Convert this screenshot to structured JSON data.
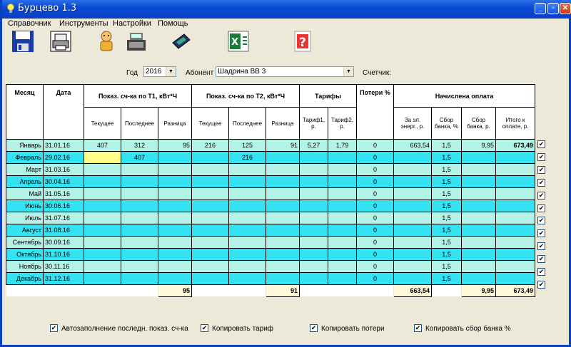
{
  "window": {
    "title": "Бурцево 1.3"
  },
  "menu": [
    "Справочник",
    "Инструменты",
    "Настройки",
    "Помощь"
  ],
  "toolbar": {
    "icons": [
      "save-icon",
      "print-icon",
      "person-icon",
      "cash-register-icon",
      "calculator-icon",
      "excel-icon",
      "help-icon"
    ]
  },
  "filter": {
    "year_label": "Год",
    "year_value": "2016",
    "subscriber_label": "Абонент",
    "subscriber_value": "Шадрина ВВ 3",
    "meter_label": "Счетчик:"
  },
  "headers": {
    "month": "Месяц",
    "date": "Дата",
    "t1": "Показ. сч-ка по Т1, кВт*Ч",
    "t2": "Показ. сч-ка по Т2, кВт*Ч",
    "tariffs": "Тарифы",
    "losses": "Потери %",
    "charged": "Начислена оплата",
    "t1_sub": [
      "Текущее",
      "Последнее",
      "Разница"
    ],
    "t2_sub": [
      "Текущее",
      "Последнее",
      "Разница"
    ],
    "tariff_sub": [
      "Тариф1, р.",
      "Тариф2, р."
    ],
    "charged_sub": [
      "За эл. энерг., р.",
      "Сбор банка, %",
      "Сбор банка, р.",
      "Итого к оплате, р."
    ]
  },
  "rows": [
    {
      "month": "Январь",
      "date": "31.01.16",
      "t1_cur": "407",
      "t1_last": "312",
      "t1_diff": "95",
      "t2_cur": "216",
      "t2_last": "125",
      "t2_diff": "91",
      "tar1": "5,27",
      "tar2": "1,79",
      "loss": "0",
      "energy": "663,54",
      "fee_pct": "1,5",
      "fee_rub": "9,95",
      "total": "673,49"
    },
    {
      "month": "Февраль",
      "date": "29.02.16",
      "t1_cur": "",
      "t1_last": "407",
      "t1_diff": "",
      "t2_cur": "",
      "t2_last": "216",
      "t2_diff": "",
      "tar1": "",
      "tar2": "",
      "loss": "0",
      "energy": "",
      "fee_pct": "1,5",
      "fee_rub": "",
      "total": ""
    },
    {
      "month": "Март",
      "date": "31.03.16",
      "t1_cur": "",
      "t1_last": "",
      "t1_diff": "",
      "t2_cur": "",
      "t2_last": "",
      "t2_diff": "",
      "tar1": "",
      "tar2": "",
      "loss": "0",
      "energy": "",
      "fee_pct": "1,5",
      "fee_rub": "",
      "total": ""
    },
    {
      "month": "Апрель",
      "date": "30.04.16",
      "t1_cur": "",
      "t1_last": "",
      "t1_diff": "",
      "t2_cur": "",
      "t2_last": "",
      "t2_diff": "",
      "tar1": "",
      "tar2": "",
      "loss": "0",
      "energy": "",
      "fee_pct": "1,5",
      "fee_rub": "",
      "total": ""
    },
    {
      "month": "Май",
      "date": "31.05.16",
      "t1_cur": "",
      "t1_last": "",
      "t1_diff": "",
      "t2_cur": "",
      "t2_last": "",
      "t2_diff": "",
      "tar1": "",
      "tar2": "",
      "loss": "0",
      "energy": "",
      "fee_pct": "1,5",
      "fee_rub": "",
      "total": ""
    },
    {
      "month": "Июнь",
      "date": "30.06.16",
      "t1_cur": "",
      "t1_last": "",
      "t1_diff": "",
      "t2_cur": "",
      "t2_last": "",
      "t2_diff": "",
      "tar1": "",
      "tar2": "",
      "loss": "0",
      "energy": "",
      "fee_pct": "1,5",
      "fee_rub": "",
      "total": ""
    },
    {
      "month": "Июль",
      "date": "31.07.16",
      "t1_cur": "",
      "t1_last": "",
      "t1_diff": "",
      "t2_cur": "",
      "t2_last": "",
      "t2_diff": "",
      "tar1": "",
      "tar2": "",
      "loss": "0",
      "energy": "",
      "fee_pct": "1,5",
      "fee_rub": "",
      "total": ""
    },
    {
      "month": "Август",
      "date": "31.08.16",
      "t1_cur": "",
      "t1_last": "",
      "t1_diff": "",
      "t2_cur": "",
      "t2_last": "",
      "t2_diff": "",
      "tar1": "",
      "tar2": "",
      "loss": "0",
      "energy": "",
      "fee_pct": "1,5",
      "fee_rub": "",
      "total": ""
    },
    {
      "month": "Сентябрь",
      "date": "30.09.16",
      "t1_cur": "",
      "t1_last": "",
      "t1_diff": "",
      "t2_cur": "",
      "t2_last": "",
      "t2_diff": "",
      "tar1": "",
      "tar2": "",
      "loss": "0",
      "energy": "",
      "fee_pct": "1,5",
      "fee_rub": "",
      "total": ""
    },
    {
      "month": "Октябрь",
      "date": "31.10.16",
      "t1_cur": "",
      "t1_last": "",
      "t1_diff": "",
      "t2_cur": "",
      "t2_last": "",
      "t2_diff": "",
      "tar1": "",
      "tar2": "",
      "loss": "0",
      "energy": "",
      "fee_pct": "1,5",
      "fee_rub": "",
      "total": ""
    },
    {
      "month": "Ноябрь",
      "date": "30.11.16",
      "t1_cur": "",
      "t1_last": "",
      "t1_diff": "",
      "t2_cur": "",
      "t2_last": "",
      "t2_diff": "",
      "tar1": "",
      "tar2": "",
      "loss": "0",
      "energy": "",
      "fee_pct": "1,5",
      "fee_rub": "",
      "total": ""
    },
    {
      "month": "Декабрь",
      "date": "31.12.16",
      "t1_cur": "",
      "t1_last": "",
      "t1_diff": "",
      "t2_cur": "",
      "t2_last": "",
      "t2_diff": "",
      "tar1": "",
      "tar2": "",
      "loss": "0",
      "energy": "",
      "fee_pct": "1,5",
      "fee_rub": "",
      "total": ""
    }
  ],
  "row_checks": [
    true,
    true,
    true,
    true,
    true,
    true,
    true,
    true,
    true,
    true,
    true,
    true
  ],
  "totals": {
    "t1_diff": "95",
    "t2_diff": "91",
    "energy": "663,54",
    "fee_rub": "9,95",
    "total": "673,49"
  },
  "options": [
    {
      "label": "Автозаполнение последн. показ. сч-ка",
      "checked": true
    },
    {
      "label": "Копировать тариф",
      "checked": true
    },
    {
      "label": "Копировать потери",
      "checked": true
    },
    {
      "label": "Копировать сбор банка %",
      "checked": true
    }
  ]
}
